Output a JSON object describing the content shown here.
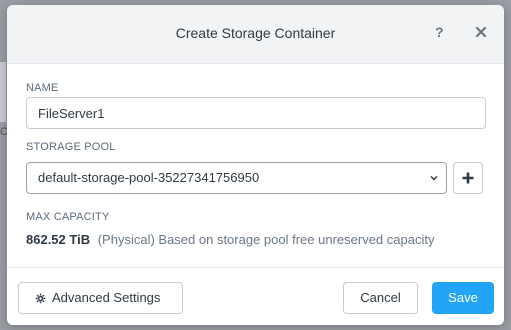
{
  "dialog": {
    "title": "Create Storage Container",
    "help_label": "?"
  },
  "form": {
    "name": {
      "label": "NAME",
      "value": "FileServer1"
    },
    "storage_pool": {
      "label": "STORAGE POOL",
      "selected": "default-storage-pool-35227341756950"
    },
    "max_capacity": {
      "label": "MAX CAPACITY",
      "value": "862.52 TiB",
      "note": "(Physical) Based on storage pool free unreserved capacity"
    }
  },
  "footer": {
    "advanced_label": "Advanced Settings",
    "cancel_label": "Cancel",
    "save_label": "Save"
  },
  "background": {
    "partial_char": "C"
  },
  "icons": {
    "close": "close-icon",
    "help": "help-icon",
    "caret": "chevron-down-icon",
    "add": "plus-icon",
    "settings": "gear-icon"
  },
  "colors": {
    "primary": "#22a5f7",
    "header_bg": "#f2f3f5",
    "overlay": "#9a9ea4"
  }
}
